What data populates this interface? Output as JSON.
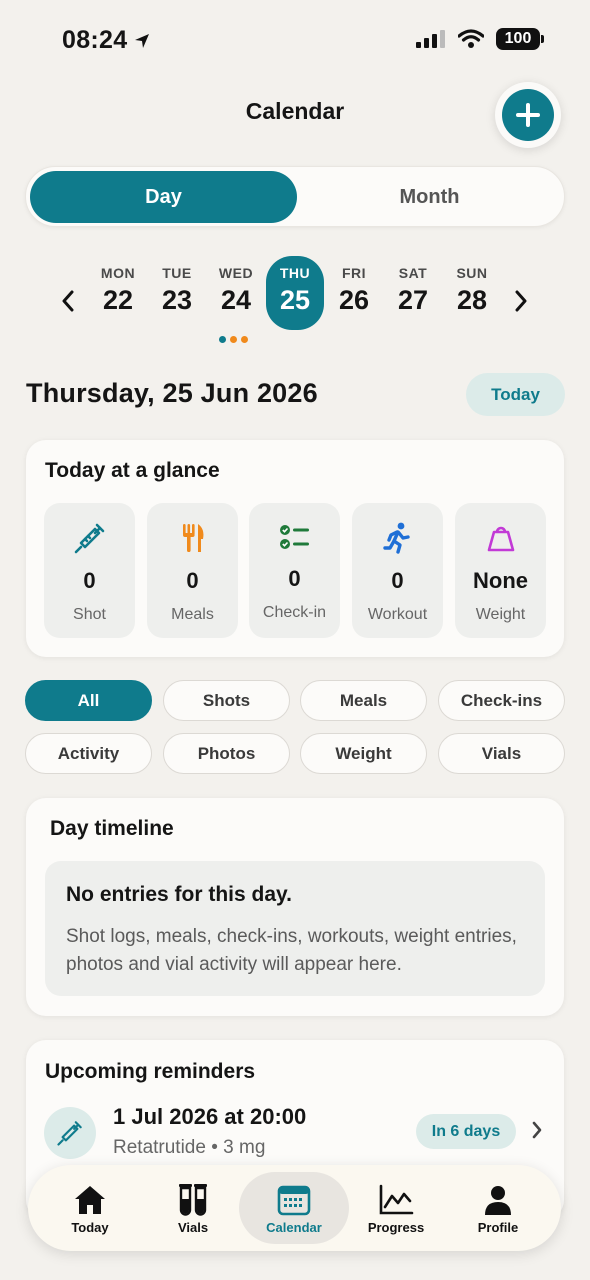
{
  "status": {
    "time": "08:24",
    "battery": "100"
  },
  "header": {
    "title": "Calendar"
  },
  "segmented": {
    "day": "Day",
    "month": "Month"
  },
  "week": {
    "days": [
      {
        "name": "MON",
        "date": "22"
      },
      {
        "name": "TUE",
        "date": "23"
      },
      {
        "name": "WED",
        "date": "24"
      },
      {
        "name": "THU",
        "date": "25"
      },
      {
        "name": "FRI",
        "date": "26"
      },
      {
        "name": "SAT",
        "date": "27"
      },
      {
        "name": "SUN",
        "date": "28"
      }
    ],
    "selected": "THU",
    "dot_colors": [
      "#0f7b8c",
      "#f08a1c",
      "#f08a1c"
    ]
  },
  "date_heading": "Thursday, 25 Jun 2026",
  "today_button": "Today",
  "glance": {
    "title": "Today at a glance",
    "tiles": [
      {
        "icon": "syringe-icon",
        "value": "0",
        "label": "Shot"
      },
      {
        "icon": "fork-knife-icon",
        "value": "0",
        "label": "Meals"
      },
      {
        "icon": "checklist-icon",
        "value": "0",
        "label": "Check-in"
      },
      {
        "icon": "running-icon",
        "value": "0",
        "label": "Workout"
      },
      {
        "icon": "scale-weight-icon",
        "value": "None",
        "label": "Weight"
      }
    ]
  },
  "filters": [
    "All",
    "Shots",
    "Meals",
    "Check-ins",
    "Activity",
    "Photos",
    "Weight",
    "Vials"
  ],
  "active_filter": "All",
  "timeline": {
    "title": "Day timeline",
    "empty_title": "No entries for this day.",
    "empty_desc": "Shot logs, meals, check-ins, workouts, weight entries, photos and vial activity will appear here."
  },
  "reminders": {
    "title": "Upcoming reminders",
    "item": {
      "date": "1 Jul 2026 at 20:00",
      "medication": "Retatrutide",
      "dose": "3 mg",
      "due": "In 6 days"
    }
  },
  "tabs": [
    {
      "label": "Today",
      "icon": "home-icon"
    },
    {
      "label": "Vials",
      "icon": "test-tubes-icon"
    },
    {
      "label": "Calendar",
      "icon": "calendar-icon"
    },
    {
      "label": "Progress",
      "icon": "chart-line-icon"
    },
    {
      "label": "Profile",
      "icon": "person-icon"
    }
  ],
  "colors": {
    "accent": "#0f7b8c",
    "accent_soft": "#dcebe9",
    "background": "#f3f1ed",
    "orange": "#f08a1c",
    "green": "#1f7a3a",
    "blue": "#1f6fd6",
    "purple": "#c23ad6"
  }
}
